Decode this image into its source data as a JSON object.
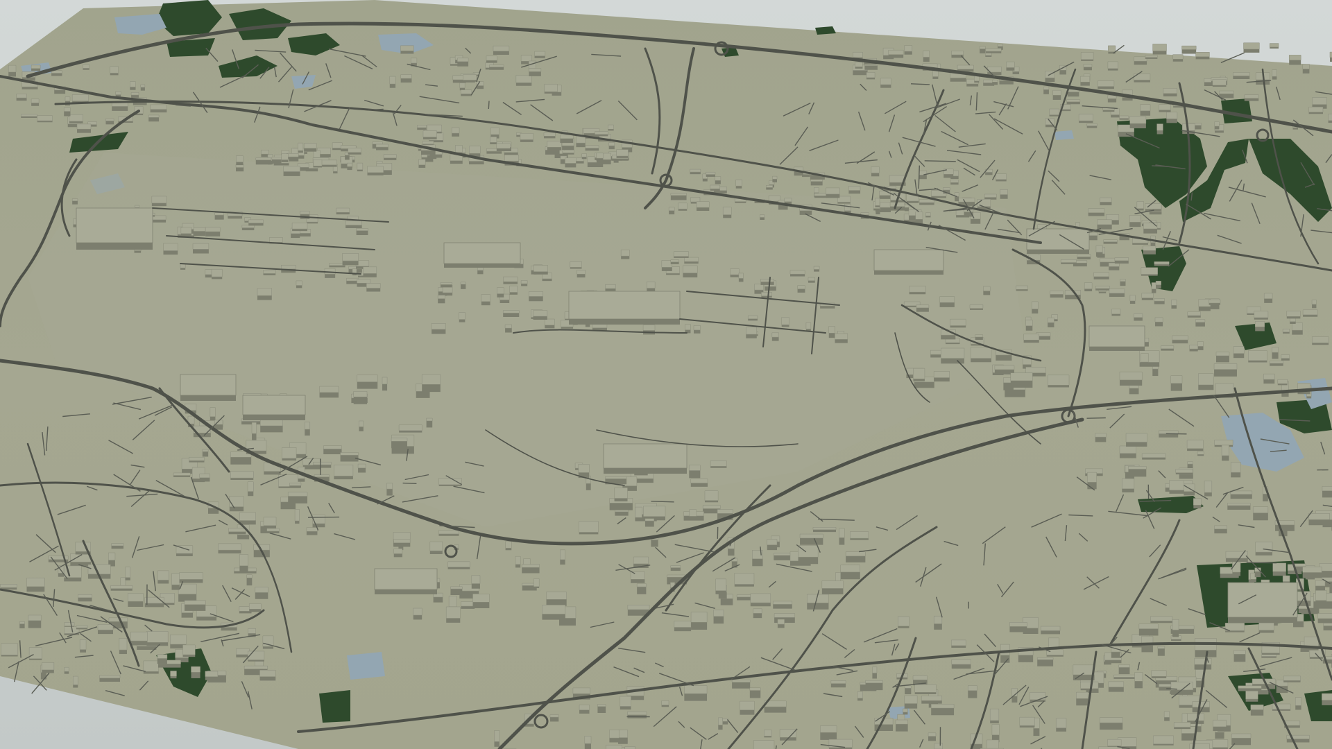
{
  "scene": {
    "kind": "3d-map-render",
    "colors": {
      "background": "#c9cfce",
      "land": "#a3a58e",
      "land_shade": "#969883",
      "road": "#4f524a",
      "building_top": "#a7a995",
      "building_side": "#7c7e6e",
      "woodland": "#2e4a2c",
      "water": "#93a6b2"
    }
  }
}
